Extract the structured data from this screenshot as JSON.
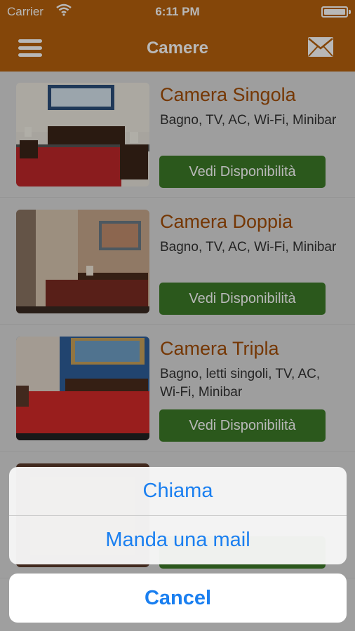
{
  "status_bar": {
    "carrier": "Carrier",
    "time": "6:11 PM"
  },
  "nav": {
    "title": "Camere"
  },
  "rooms": [
    {
      "title": "Camera Singola",
      "description": "Bagno, TV, AC, Wi-Fi, Minibar",
      "button": "Vedi Disponibilità"
    },
    {
      "title": "Camera Doppia",
      "description": "Bagno, TV, AC, Wi-Fi, Minibar",
      "button": "Vedi Disponibilità"
    },
    {
      "title": "Camera Tripla",
      "description": "Bagno, letti singoli, TV, AC, Wi-Fi, Minibar",
      "button": "Vedi Disponibilità"
    }
  ],
  "action_sheet": {
    "options": [
      "Chiama",
      "Manda una mail"
    ],
    "cancel": "Cancel"
  },
  "colors": {
    "nav": "#b8620d",
    "title_text": "#a24d06",
    "button": "#3c7a27",
    "ios_blue": "#1a7ff0"
  }
}
